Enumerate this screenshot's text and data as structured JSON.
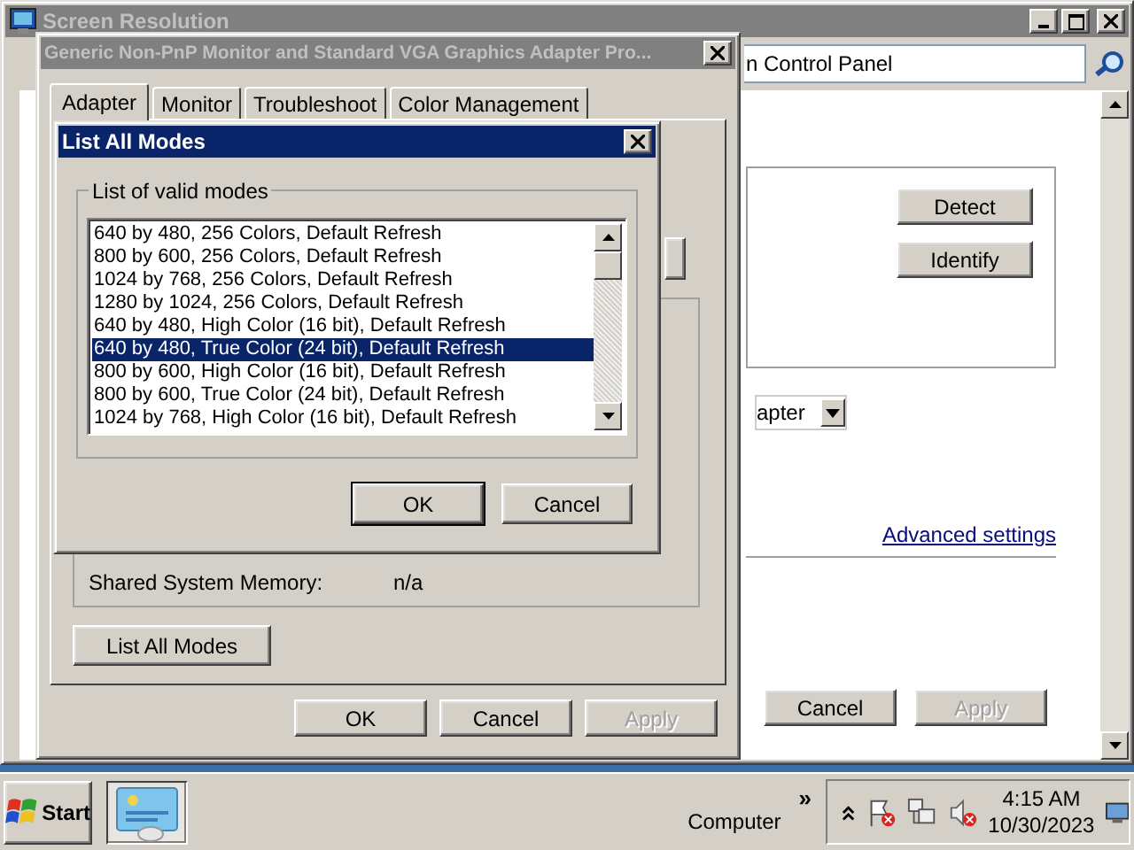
{
  "background_window": {
    "title": "Screen Resolution",
    "active": false,
    "address": "n Control Panel",
    "detect_button": "Detect",
    "identify_button": "Identify",
    "dropdown_value": "apter",
    "link": "Advanced settings",
    "buttons": [
      {
        "label": "Cancel",
        "disabled": false
      },
      {
        "label": "Apply",
        "disabled": true
      }
    ]
  },
  "properties_dialog": {
    "title": "Generic Non-PnP Monitor and Standard VGA Graphics Adapter Pro...",
    "active": false,
    "tabs": [
      {
        "label": "Adapter",
        "selected": true
      },
      {
        "label": "Monitor",
        "selected": false
      },
      {
        "label": "Troubleshoot",
        "selected": false
      },
      {
        "label": "Color Management",
        "selected": false
      }
    ],
    "memory_rows": [
      {
        "label": "Shared System Memory:",
        "value": "n/a"
      }
    ],
    "list_all_modes_button": "List All Modes",
    "buttons": [
      {
        "label": "OK",
        "disabled": false
      },
      {
        "label": "Cancel",
        "disabled": false
      },
      {
        "label": "Apply",
        "disabled": true
      }
    ]
  },
  "modes_dialog": {
    "title": "List All Modes",
    "active": true,
    "group_label": "List of valid modes",
    "modes": [
      {
        "label": "640 by 480, 256 Colors, Default Refresh",
        "selected": false
      },
      {
        "label": "800 by 600, 256 Colors, Default Refresh",
        "selected": false
      },
      {
        "label": "1024 by 768, 256 Colors, Default Refresh",
        "selected": false
      },
      {
        "label": "1280 by 1024, 256 Colors, Default Refresh",
        "selected": false
      },
      {
        "label": "640 by 480, High Color (16 bit), Default Refresh",
        "selected": false
      },
      {
        "label": "640 by 480, True Color (24 bit), Default Refresh",
        "selected": true
      },
      {
        "label": "800 by 600, High Color (16 bit), Default Refresh",
        "selected": false
      },
      {
        "label": "800 by 600, True Color (24 bit), Default Refresh",
        "selected": false
      },
      {
        "label": "1024 by 768, High Color (16 bit), Default Refresh",
        "selected": false
      }
    ],
    "buttons": [
      {
        "label": "OK",
        "default": true
      },
      {
        "label": "Cancel",
        "default": false
      }
    ]
  },
  "taskbar": {
    "start": "Start",
    "toolbar_label": "Computer",
    "toolbar_chevron": "»",
    "time": "4:15 AM",
    "date": "10/30/2023"
  }
}
